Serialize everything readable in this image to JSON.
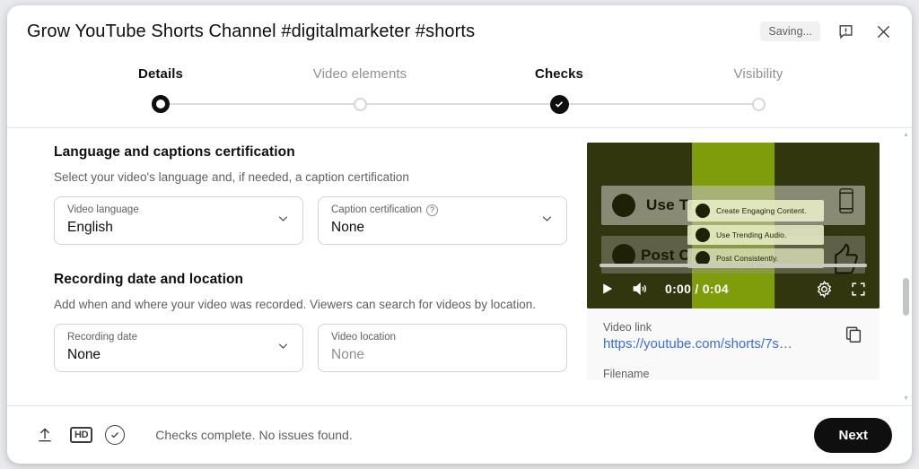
{
  "header": {
    "title": "Grow YouTube Shorts Channel #digitalmarketer #shorts",
    "saving_badge": "Saving...",
    "feedback_icon": "feedback-bubble-icon",
    "close_icon": "close-icon"
  },
  "stepper": {
    "steps": [
      {
        "label": "Details",
        "state": "active"
      },
      {
        "label": "Video elements",
        "state": "inactive"
      },
      {
        "label": "Checks",
        "state": "done"
      },
      {
        "label": "Visibility",
        "state": "inactive"
      }
    ]
  },
  "sections": [
    {
      "title": "Language and captions certification",
      "subtitle": "Select your video's language and, if needed, a caption certification",
      "fields": [
        {
          "label": "Video language",
          "value": "English",
          "type": "dropdown",
          "help": false
        },
        {
          "label": "Caption certification",
          "value": "None",
          "type": "dropdown",
          "help": true
        }
      ]
    },
    {
      "title": "Recording date and location",
      "subtitle": "Add when and where your video was recorded. Viewers can search for videos by location.",
      "fields": [
        {
          "label": "Recording date",
          "value": "None",
          "type": "dropdown",
          "help": false
        },
        {
          "label": "Video location",
          "value": "None",
          "type": "input-placeholder",
          "help": false
        }
      ]
    }
  ],
  "preview": {
    "overlay_lines": [
      "Create Engaging Content.",
      "Use Trending Audio.",
      "Post Consistently."
    ],
    "big_text_1": "Use Tr",
    "big_text_2": "Post C",
    "time": "0:00 / 0:04",
    "play_icon": "play-icon",
    "volume_icon": "volume-icon",
    "settings_icon": "gear-icon",
    "fullscreen_icon": "fullscreen-icon",
    "phone_icon": "phone-icon",
    "thumbs_up_icon": "thumbs-up-icon",
    "colors": {
      "accent_green": "#7f9c0a",
      "dark_olive": "#32360f"
    }
  },
  "link_panel": {
    "video_link_label": "Video link",
    "video_link_value": "https://youtube.com/shorts/7s…",
    "filename_label": "Filename",
    "copy_icon": "copy-icon",
    "link_color": "#3a6fd8"
  },
  "footer": {
    "upload_icon": "upload-icon",
    "hd_badge": "HD",
    "check_icon": "check-circle-icon",
    "status_text": "Checks complete. No issues found.",
    "next_label": "Next"
  }
}
